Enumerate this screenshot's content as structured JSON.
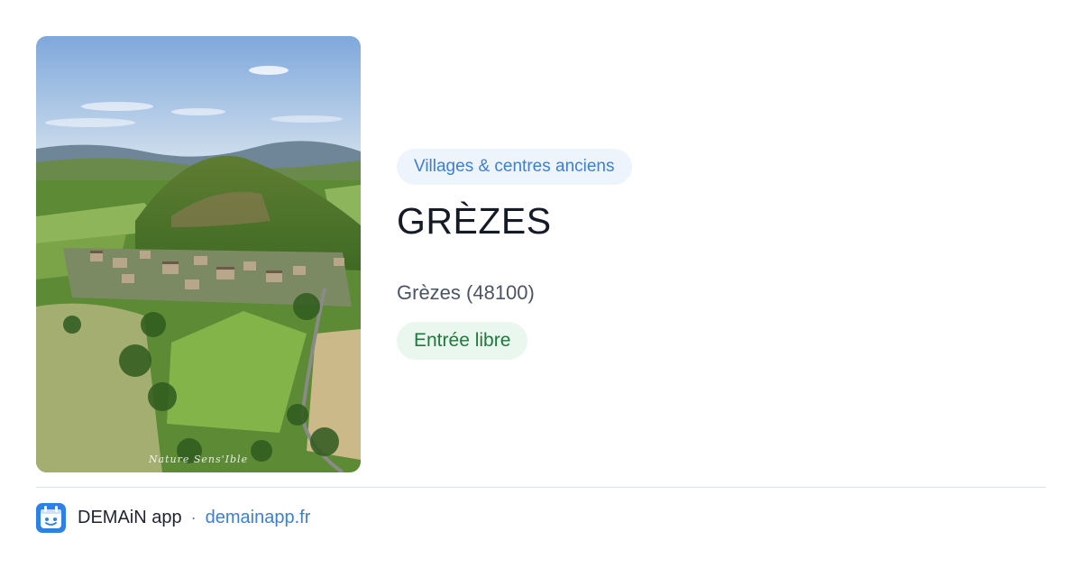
{
  "image": {
    "alt": "GRÈZES",
    "watermark": "Nature Sens'Ible"
  },
  "category": "Villages & centres anciens",
  "title": "GRÈZES",
  "location": "Grèzes (48100)",
  "access": "Entrée libre",
  "footer": {
    "app_name": "DEMAiN app",
    "separator": "·",
    "url": "demainapp.fr",
    "logo_icon": "app-logo-icon"
  },
  "colors": {
    "accent": "#3f7fcf",
    "category_bg": "#edf4fc",
    "access_text": "#1d7a3c",
    "access_bg": "#eaf7ee",
    "title": "#141a26"
  }
}
